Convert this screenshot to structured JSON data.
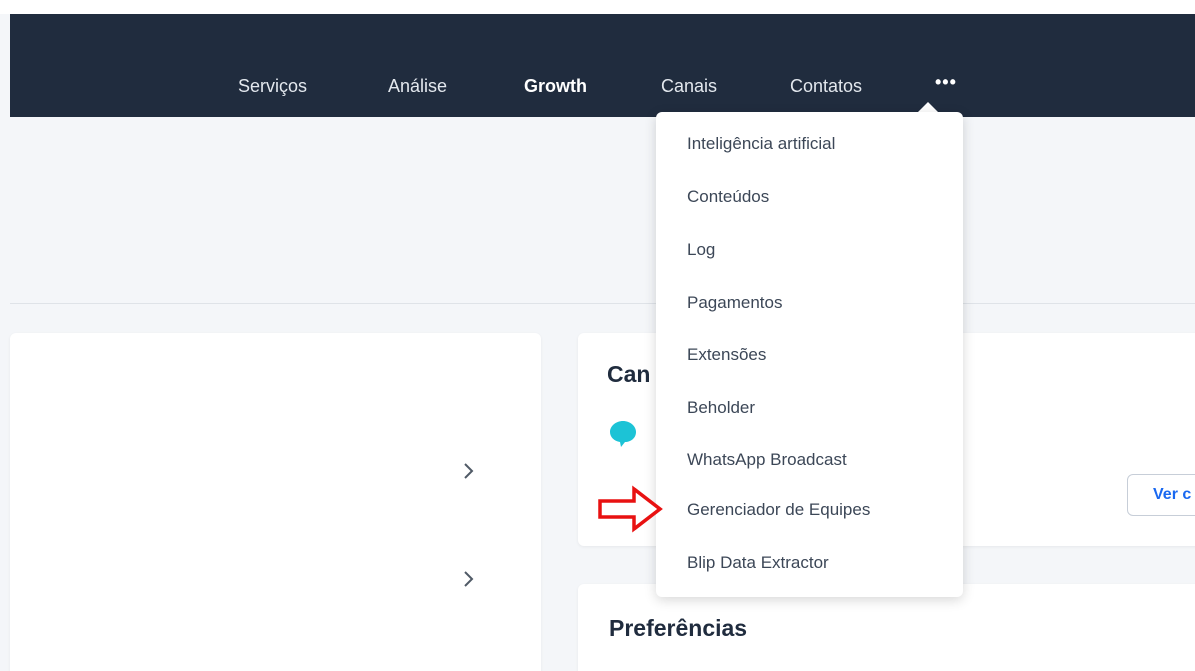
{
  "navbar": {
    "items": [
      {
        "label": "Serviços",
        "active": false
      },
      {
        "label": "Análise",
        "active": false
      },
      {
        "label": "Growth",
        "active": true
      },
      {
        "label": "Canais",
        "active": false
      },
      {
        "label": "Contatos",
        "active": false
      }
    ],
    "more_label": "•••"
  },
  "dropdown": {
    "items": [
      "Inteligência artificial",
      "Conteúdos",
      "Log",
      "Pagamentos",
      "Extensões",
      "Beholder",
      "WhatsApp Broadcast",
      "Gerenciador de Equipes",
      "Blip Data Extractor"
    ],
    "highlighted_item": "Gerenciador de Equipes"
  },
  "channels_card": {
    "title": "Can",
    "button_label": "Ver c",
    "icon": "chat-bubble-icon"
  },
  "preferences_card": {
    "title": "Preferências"
  },
  "left_card": {
    "icons": [
      "chevron-right-icon",
      "chevron-right-icon"
    ]
  },
  "colors": {
    "navbar_bg": "#202c3e",
    "page_bg": "#f4f6f9",
    "accent_blue": "#1968f0",
    "bubble_teal": "#1cc3d6",
    "annotation_red": "#e81111"
  }
}
